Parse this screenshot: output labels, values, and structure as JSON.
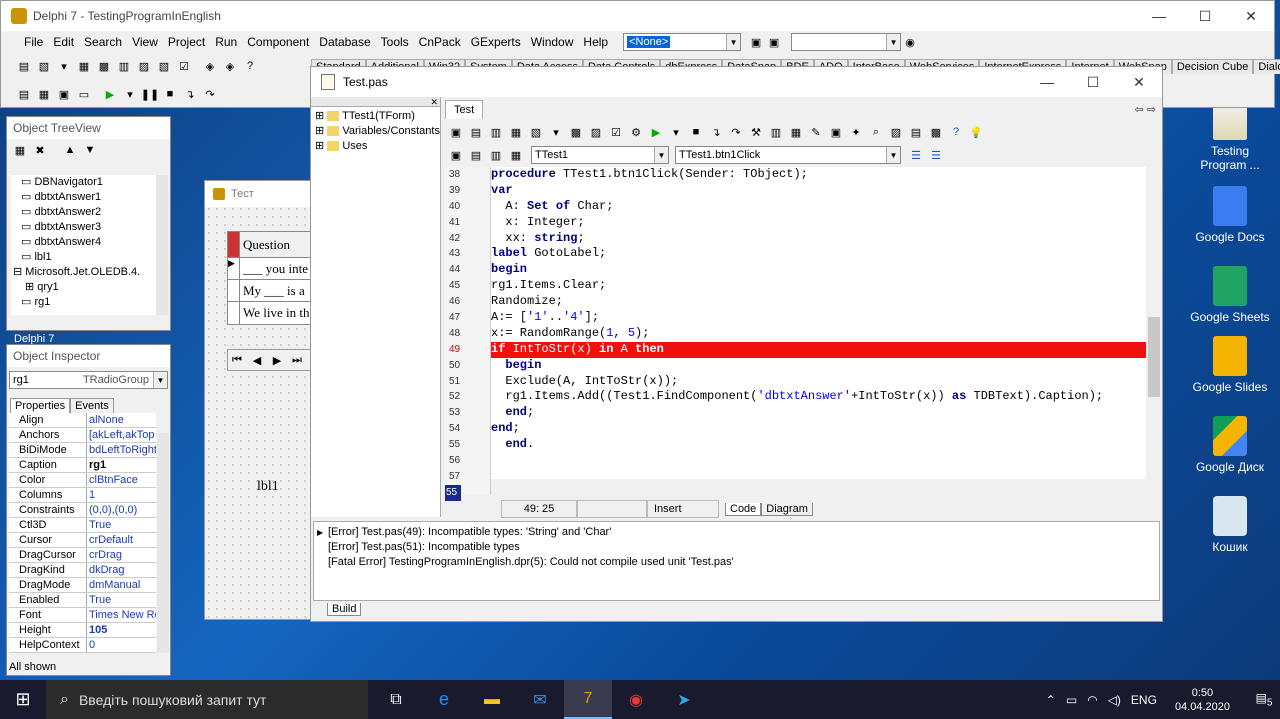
{
  "main_window": {
    "title": "Delphi 7 - TestingProgramInEnglish",
    "menu": [
      "File",
      "Edit",
      "Search",
      "View",
      "Project",
      "Run",
      "Component",
      "Database",
      "Tools",
      "CnPack",
      "GExperts",
      "Window",
      "Help"
    ],
    "combo_none": "<None>",
    "palette_tabs": [
      "Standard",
      "Additional",
      "Win32",
      "System",
      "Data Access",
      "Data Controls",
      "dbExpress",
      "DataSnap",
      "BDE",
      "ADO",
      "InterBase",
      "WebServices",
      "InternetExpress",
      "Internet",
      "WebSnap",
      "Decision Cube",
      "Dialo"
    ]
  },
  "tree_view": {
    "title": "Object TreeView",
    "items": [
      "DBNavigator1",
      "dbtxtAnswer1",
      "dbtxtAnswer2",
      "dbtxtAnswer3",
      "dbtxtAnswer4",
      "lbl1",
      "Microsoft.Jet.OLEDB.4.",
      "qry1",
      "rg1"
    ]
  },
  "delphi_label": "Delphi 7",
  "inspector": {
    "title": "Object Inspector",
    "selected": "rg1",
    "selected_type": "TRadioGroup",
    "tab_properties": "Properties",
    "tab_events": "Events",
    "rows": [
      [
        "Align",
        "alNone"
      ],
      [
        "Anchors",
        "[akLeft,akTop"
      ],
      [
        "BiDiMode",
        "bdLeftToRight"
      ],
      [
        "Caption",
        "rg1"
      ],
      [
        "Color",
        "clBtnFace"
      ],
      [
        "Columns",
        "1"
      ],
      [
        "Constraints",
        "(0,0),(0,0)"
      ],
      [
        "Ctl3D",
        "True"
      ],
      [
        "Cursor",
        "crDefault"
      ],
      [
        "DragCursor",
        "crDrag"
      ],
      [
        "DragKind",
        "dkDrag"
      ],
      [
        "DragMode",
        "dmManual"
      ],
      [
        "Enabled",
        "True"
      ],
      [
        "Font",
        "Times New Ro"
      ],
      [
        "Height",
        "105"
      ],
      [
        "HelpContext",
        "0"
      ]
    ],
    "status": "All shown"
  },
  "form": {
    "title": "Тест",
    "grid_header": "Question",
    "rows": [
      "___ you inte",
      "My ___ is a",
      "We live in th"
    ],
    "label": "lbl1"
  },
  "editor": {
    "title": "Test.pas",
    "tab": "Test",
    "explorer": [
      "TTest1(TForm)",
      "Variables/Constants",
      "Uses"
    ],
    "class_combo": "TTest1",
    "method_combo": "TTest1.btn1Click",
    "line_numbers": [
      "38",
      "39",
      "40",
      "41",
      "42",
      "43",
      "44",
      "45",
      "46",
      "47",
      "48",
      "49",
      "50",
      "51",
      "52",
      "53",
      "54",
      "55",
      "56",
      "57",
      "55"
    ],
    "status_pos": "49: 25",
    "status_mode": "Insert",
    "tab_code": "Code",
    "tab_diagram": "Diagram",
    "messages": [
      "[Error] Test.pas(49): Incompatible types: 'String' and 'Char'",
      "[Error] Test.pas(51): Incompatible types",
      "[Fatal Error] TestingProgramInEnglish.dpr(5): Could not compile used unit 'Test.pas'"
    ],
    "build_tab": "Build"
  },
  "desktop_icons": [
    "Testing Program ...",
    "Google Docs",
    "Google Sheets",
    "Google Slides",
    "Google Диск",
    "Кошик"
  ],
  "taskbar": {
    "search": "Введіть пошуковий запит тут",
    "lang": "ENG",
    "time": "0:50",
    "date": "04.04.2020",
    "notif": "5"
  }
}
